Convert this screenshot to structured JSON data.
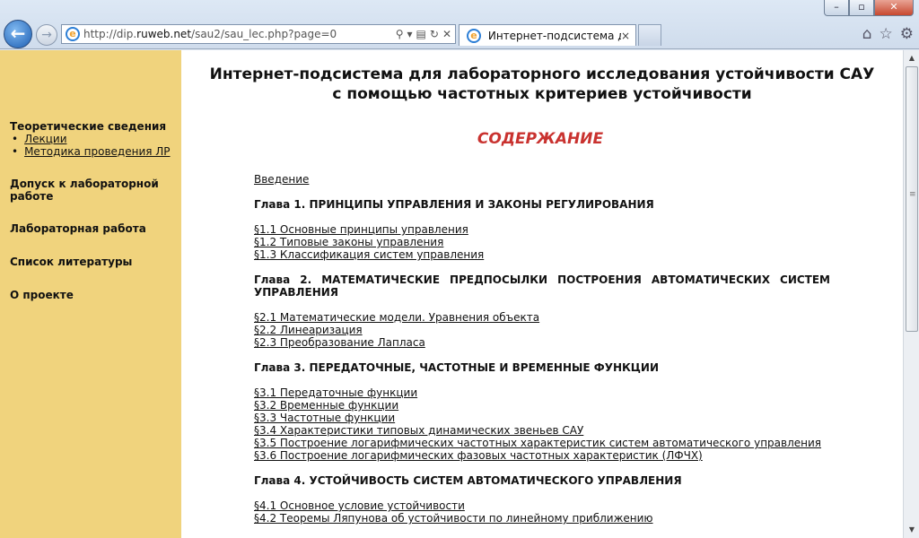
{
  "browser": {
    "url_prefix": "http://dip.",
    "url_domain": "ruweb.net",
    "url_path": "/sau2/sau_lec.php?page=0",
    "tab_title": "Интернет-подсистема для...",
    "tab_close": "×"
  },
  "sidebar": {
    "section_theory": "Теоретические сведения",
    "theory_items": [
      "Лекции",
      "Методика проведения ЛР"
    ],
    "admission": "Допуск к лабораторной работе",
    "lab_work": "Лабораторная работа",
    "literature": "Список литературы",
    "about": "О проекте"
  },
  "header": {
    "title_line1": "Интернет-подсистема для лабораторного исследования устойчивости САУ",
    "title_line2": "с помощью частотных критериев устойчивости",
    "toc_title": "СОДЕРЖАНИЕ"
  },
  "toc": {
    "intro": "Введение",
    "ch1": "Глава 1. ПРИНЦИПЫ УПРАВЛЕНИЯ И ЗАКОНЫ РЕГУЛИРОВАНИЯ",
    "ch1_items": [
      "§1.1 Основные принципы управления",
      "§1.2 Типовые законы управления",
      "§1.3 Классификация систем управления"
    ],
    "ch2": "Глава 2. МАТЕМАТИЧЕСКИЕ ПРЕДПОСЫЛКИ ПОСТРОЕНИЯ АВТОМАТИЧЕСКИХ СИСТЕМ УПРАВЛЕНИЯ",
    "ch2_items": [
      "§2.1 Математические модели. Уравнения объекта",
      "§2.2 Линеаризация",
      "§2.3 Преобразование Лапласа"
    ],
    "ch3": "Глава 3. ПЕРЕДАТОЧНЫЕ, ЧАСТОТНЫЕ И ВРЕМЕННЫЕ ФУНКЦИИ",
    "ch3_items": [
      "§3.1 Передаточные функции",
      "§3.2 Временные функции",
      "§3.3 Частотные функции",
      "§3.4 Характеристики типовых динамических звеньев САУ",
      "§3.5 Построение логарифмических частотных характеристик систем автоматического управления",
      "§3.6 Построение логарифмических фазовых частотных характеристик (ЛФЧХ)"
    ],
    "ch4": "Глава 4. УСТОЙЧИВОСТЬ СИСТЕМ АВТОМАТИЧЕСКОГО УПРАВЛЕНИЯ",
    "ch4_items": [
      "§4.1 Основное условие устойчивости",
      "§4.2 Теоремы Ляпунова об устойчивости по линейному приближению"
    ]
  }
}
